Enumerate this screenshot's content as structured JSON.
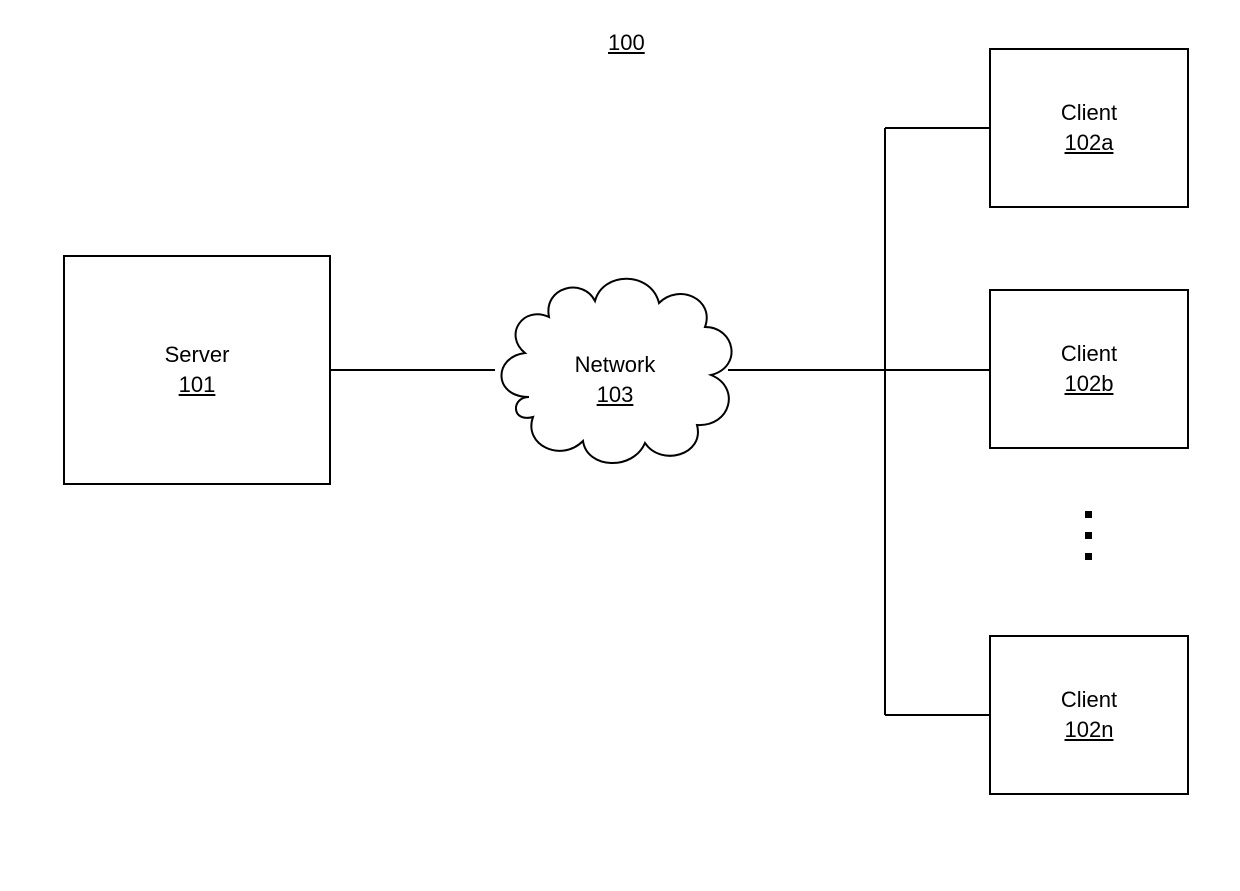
{
  "figure": {
    "number": "100"
  },
  "server": {
    "label": "Server",
    "number": "101"
  },
  "network": {
    "label": "Network",
    "number": "103"
  },
  "clients": [
    {
      "label": "Client",
      "number": "102a"
    },
    {
      "label": "Client",
      "number": "102b"
    },
    {
      "label": "Client",
      "number": "102n"
    }
  ]
}
